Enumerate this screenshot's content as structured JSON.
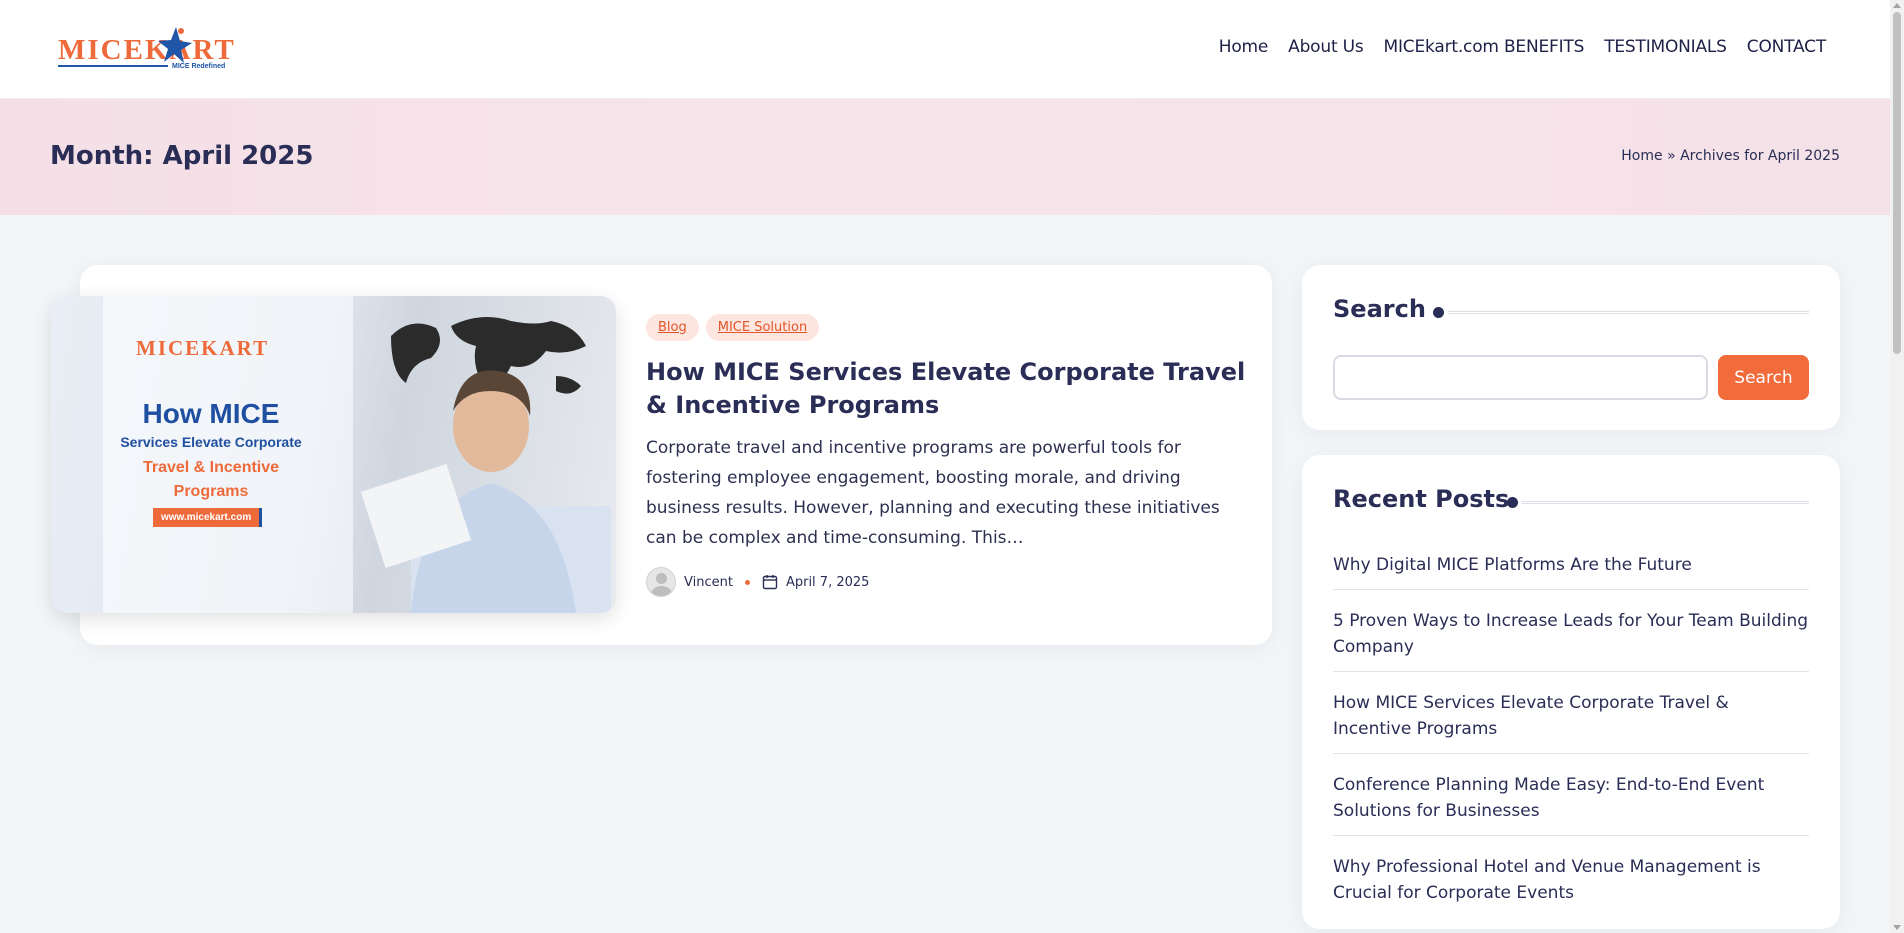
{
  "header": {
    "logo_word": "MICEKART",
    "logo_tagline": "MICE Redefined",
    "nav": [
      {
        "label": "Home"
      },
      {
        "label": "About Us"
      },
      {
        "label": "MICEkart.com BENEFITS"
      },
      {
        "label": "TESTIMONIALS"
      },
      {
        "label": "CONTACT"
      }
    ]
  },
  "title_band": {
    "title": "Month: April 2025",
    "breadcrumb_home": "Home",
    "breadcrumb_sep": " » ",
    "breadcrumb_current": "Archives for April 2025"
  },
  "post": {
    "image": {
      "logo": "MICEKART",
      "line1": "How MICE",
      "line2": "Services Elevate Corporate",
      "line3": "Travel & Incentive Programs",
      "url": "www.micekart.com"
    },
    "tags": [
      "Blog",
      "MICE Solution"
    ],
    "title": "How MICE Services Elevate Corporate Travel & Incentive Programs",
    "excerpt": "Corporate travel and incentive programs are powerful tools for fostering employee engagement, boosting morale, and driving business results. However, planning and executing these initiatives can be complex and time-consuming. This…",
    "author": "Vincent",
    "date": "April 7, 2025"
  },
  "sidebar": {
    "search": {
      "title": "Search",
      "input_value": "",
      "button_label": "Search"
    },
    "recent": {
      "title": "Recent Posts",
      "items": [
        "Why Digital MICE Platforms Are the Future",
        "5 Proven Ways to Increase Leads for Your Team Building Company",
        "How MICE Services Elevate Corporate Travel & Incentive Programs",
        "Conference Planning Made Easy: End-to-End Event Solutions for Businesses",
        "Why Professional Hotel and Venue Management is Crucial for Corporate Events"
      ]
    }
  },
  "colors": {
    "accent": "#f26b3b",
    "navy": "#2a2d55",
    "band": "#f5e1e8",
    "tag_bg": "#fde6df"
  }
}
